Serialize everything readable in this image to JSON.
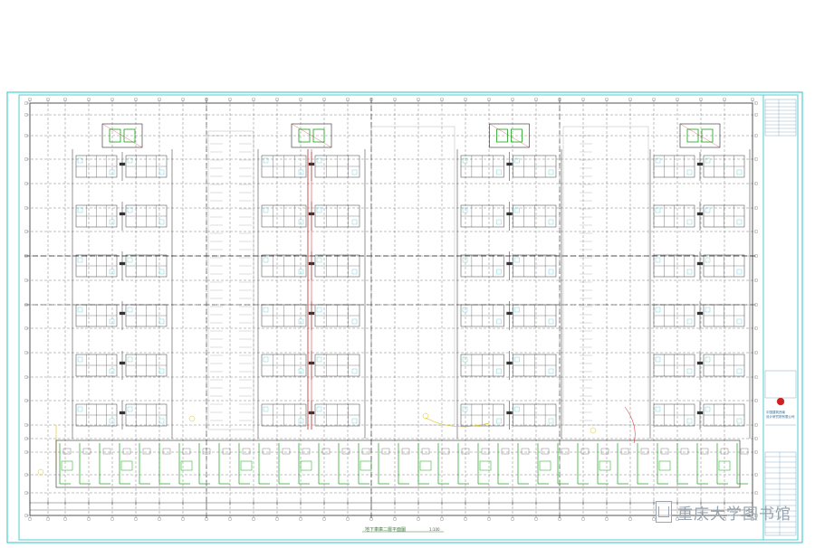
{
  "drawing": {
    "title": "地下車庫二層平面圖",
    "scale": "1:100",
    "colors": {
      "frame": "#28c2c8",
      "grid": "#4a4a4a",
      "walls": "#2a2a2a",
      "green": "#17a317",
      "yellow": "#d9c21a",
      "red": "#d02020",
      "cyan_detail": "#1fb7c8"
    }
  },
  "title_block": {
    "company_lines": [
      "中国建筑西南",
      "设计研究院有限公司"
    ],
    "logo": "red-circle-seal"
  },
  "watermark": {
    "text": "重庆大学图书馆"
  }
}
